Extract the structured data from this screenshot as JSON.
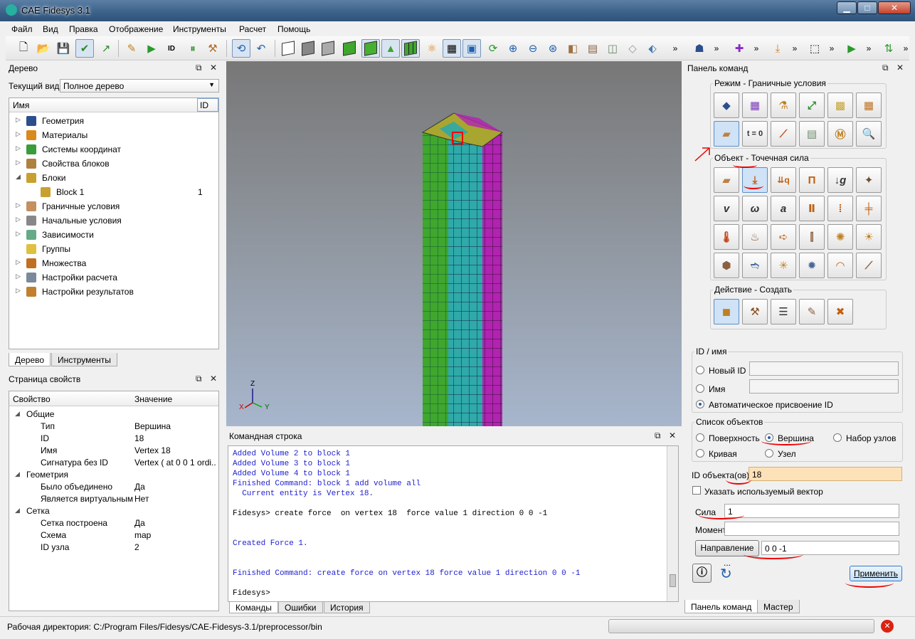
{
  "app": {
    "title": "CAE Fidesys 3.1"
  },
  "window_buttons": {
    "minimize": "▁",
    "maximize": "□",
    "close": "✕"
  },
  "menu": [
    "Файл",
    "Вид",
    "Правка",
    "Отображение",
    "Инструменты",
    "Расчет",
    "Помощь"
  ],
  "tree_panel": {
    "title": "Дерево",
    "current_view_label": "Текущий вид",
    "current_view_value": "Полное дерево",
    "col_name": "Имя",
    "col_id": "ID",
    "items": [
      {
        "label": "Геометрия",
        "id": "",
        "icon": "geometry-icon",
        "color": "#2a4f8c"
      },
      {
        "label": "Материалы",
        "id": "",
        "icon": "materials-icon",
        "color": "#d98a1c"
      },
      {
        "label": "Системы координат",
        "id": "",
        "icon": "coordinate-system-icon",
        "color": "#3a9c3a"
      },
      {
        "label": "Свойства блоков",
        "id": "",
        "icon": "block-properties-icon",
        "color": "#b08040"
      },
      {
        "label": "Блоки",
        "id": "",
        "icon": "blocks-icon",
        "color": "#c8a030"
      },
      {
        "label": "Block 1",
        "id": "1",
        "icon": "block-icon",
        "color": "#c8a030"
      },
      {
        "label": "Граничные условия",
        "id": "",
        "icon": "boundary-conditions-icon",
        "color": "#c49060"
      },
      {
        "label": "Начальные условия",
        "id": "",
        "icon": "initial-conditions-icon",
        "color": "#888"
      },
      {
        "label": "Зависимости",
        "id": "",
        "icon": "dependencies-icon",
        "color": "#6a8"
      },
      {
        "label": "Группы",
        "id": "",
        "icon": "groups-icon",
        "color": "#e0c040"
      },
      {
        "label": "Множества",
        "id": "",
        "icon": "sets-icon",
        "color": "#c07020"
      },
      {
        "label": "Настройки расчета",
        "id": "",
        "icon": "calc-settings-icon",
        "color": "#7a8a9a"
      },
      {
        "label": "Настройки результатов",
        "id": "",
        "icon": "results-settings-icon",
        "color": "#c08030"
      }
    ],
    "tabs": [
      "Дерево",
      "Инструменты"
    ]
  },
  "properties_panel": {
    "title": "Страница свойств",
    "col_property": "Свойство",
    "col_value": "Значение",
    "rows": [
      {
        "key": "Общие",
        "value": "",
        "level": 0
      },
      {
        "key": "Тип",
        "value": "Вершина",
        "level": 1
      },
      {
        "key": "ID",
        "value": "18",
        "level": 1
      },
      {
        "key": "Имя",
        "value": "Vertex 18",
        "level": 1
      },
      {
        "key": "Сигнатура без ID",
        "value": "Vertex ( at 0 0 1 ordi...",
        "level": 1
      },
      {
        "key": "Геометрия",
        "value": "",
        "level": 0
      },
      {
        "key": "Было объединено",
        "value": "Да",
        "level": 1
      },
      {
        "key": "Является виртуальным",
        "value": "Нет",
        "level": 1
      },
      {
        "key": "Сетка",
        "value": "",
        "level": 0
      },
      {
        "key": "Сетка построена",
        "value": "Да",
        "level": 1
      },
      {
        "key": "Схема",
        "value": "map",
        "level": 1
      },
      {
        "key": "ID узла",
        "value": "2",
        "level": 1
      }
    ]
  },
  "viewport": {
    "axes": {
      "z": "Z",
      "x": "X",
      "y": "Y"
    }
  },
  "command_line": {
    "title": "Командная строка",
    "lines": [
      {
        "text": "Added Volume 2 to block 1",
        "color": "blue"
      },
      {
        "text": "Added Volume 3 to block 1",
        "color": "blue"
      },
      {
        "text": "Added Volume 4 to block 1",
        "color": "blue"
      },
      {
        "text": "Finished Command: block 1 add volume all",
        "color": "blue"
      },
      {
        "text": "  Current entity is Vertex 18.",
        "color": "blue"
      },
      {
        "text": "",
        "color": "black"
      },
      {
        "text": "Fidesys> create force  on vertex 18  force value 1 direction 0 0 -1",
        "color": "black"
      },
      {
        "text": "",
        "color": "black"
      },
      {
        "text": "",
        "color": "black"
      },
      {
        "text": "Created Force 1.",
        "color": "blue"
      },
      {
        "text": "",
        "color": "black"
      },
      {
        "text": "",
        "color": "black"
      },
      {
        "text": "Finished Command: create force on vertex 18 force value 1 direction 0 0 -1",
        "color": "blue"
      },
      {
        "text": "",
        "color": "black"
      },
      {
        "text": "Fidesys>",
        "color": "black"
      }
    ],
    "tabs": [
      "Команды",
      "Ошибки",
      "История"
    ]
  },
  "command_panel": {
    "title": "Панель команд",
    "mode_label": "Режим - Граничные условия",
    "object_label": "Объект - Точечная сила",
    "action_label": "Действие - Создать",
    "id_group": "ID / имя",
    "new_id": "Новый ID",
    "name": "Имя",
    "auto_id": "Автоматическое присвоение ID",
    "objects_group": "Список объектов",
    "surface": "Поверхность",
    "vertex": "Вершина",
    "node_set": "Набор узлов",
    "curve": "Кривая",
    "node": "Узел",
    "object_ids_label": "ID объекта(ов)",
    "object_ids_value": "18",
    "use_vector": "Указать используемый вектор",
    "force_label": "Сила",
    "force_value": "1",
    "moment_label": "Момент",
    "moment_value": "",
    "direction_button": "Направление ...",
    "direction_value": "0 0 -1",
    "apply": "Применить",
    "tabs": [
      "Панель команд",
      "Мастер"
    ],
    "t0": "t = 0"
  },
  "status": {
    "workdir": "Рабочая директория: C:/Program Files/Fidesys/CAE-Fidesys-3.1/preprocessor/bin"
  },
  "colors": {
    "green_face": "#3fa62e",
    "cyan_face": "#2fa9a9",
    "magenta_face": "#b123b1",
    "olive_top": "#a8a630",
    "annotation": "#e00000"
  }
}
